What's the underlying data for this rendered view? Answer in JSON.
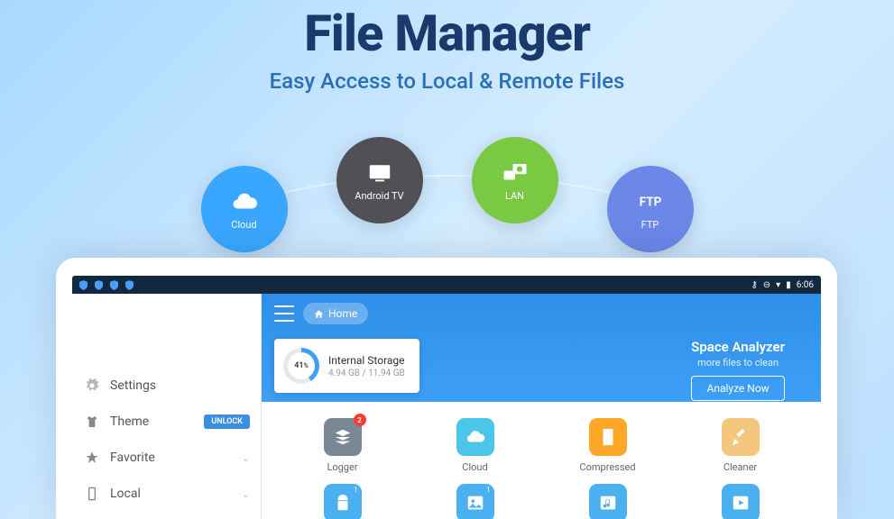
{
  "hero": {
    "title": "File Manager",
    "subtitle": "Easy Access to Local & Remote Files"
  },
  "circles": {
    "cloud": "Cloud",
    "tv": "Android TV",
    "lan": "LAN",
    "ftp": "FTP"
  },
  "statusbar": {
    "time": "6:06"
  },
  "sidebar": {
    "items": [
      {
        "label": "Settings"
      },
      {
        "label": "Theme",
        "badge": "UNLOCK"
      },
      {
        "label": "Favorite"
      },
      {
        "label": "Local"
      }
    ]
  },
  "breadcrumb": {
    "home": "Home"
  },
  "storage": {
    "percent": "41",
    "percent_suffix": "%",
    "name": "Internal Storage",
    "size": "4.94 GB / 11.94 GB"
  },
  "analyzer": {
    "title": "Space Analyzer",
    "subtitle": "more files to clean",
    "button": "Analyze Now"
  },
  "grid": {
    "items": [
      {
        "label": "Logger",
        "badge": "2"
      },
      {
        "label": "Cloud"
      },
      {
        "label": "Compressed"
      },
      {
        "label": "Cleaner"
      }
    ],
    "row2_badge": "1"
  }
}
